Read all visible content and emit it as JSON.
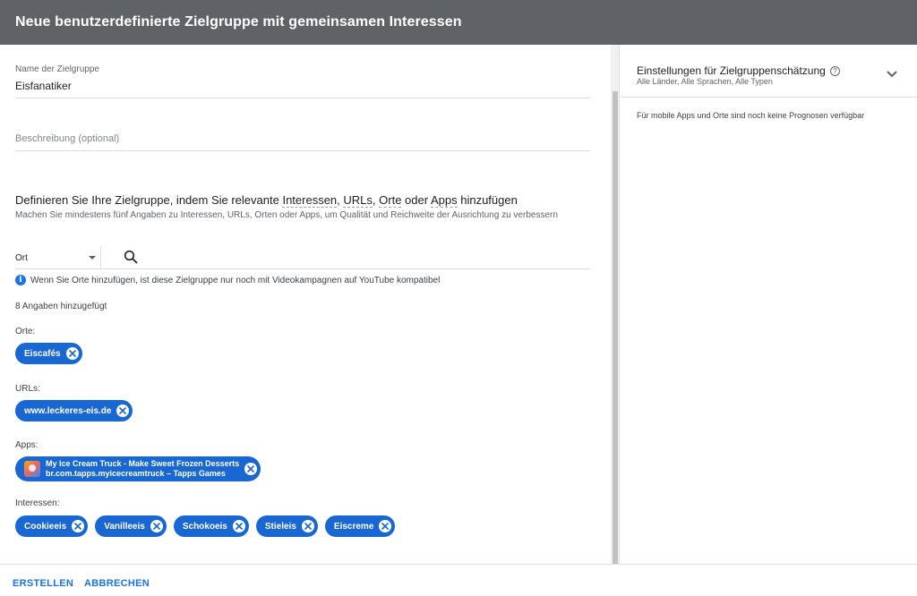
{
  "header": {
    "title": "Neue benutzerdefinierte Zielgruppe mit gemeinsamen Interessen"
  },
  "form": {
    "name_label": "Name der Zielgruppe",
    "name_value": "Eisfanatiker",
    "description_placeholder": "Beschreibung (optional)"
  },
  "define": {
    "title_prefix": "Definieren Sie Ihre Zielgruppe, indem Sie relevante ",
    "interests": "Interessen",
    "comma1": ", ",
    "urls": "URLs",
    "comma2": ", ",
    "places": "Orte",
    "or": " oder ",
    "apps": "Apps",
    "title_suffix": " hinzufügen",
    "subtitle": "Machen Sie mindestens fünf Angaben zu Interessen, URLs, Orten oder Apps, um Qualität und Reichweite der Ausrichtung zu verbessern"
  },
  "search": {
    "type_selected": "Ort"
  },
  "info": {
    "icon": "info-icon",
    "text": "Wenn Sie Orte hinzufügen, ist diese Zielgruppe nur noch mit Videokampagnen auf YouTube kompatibel"
  },
  "count_text": "8 Angaben hinzugefügt",
  "groups": {
    "places": {
      "label": "Orte:",
      "chips": [
        "Eiscafés"
      ]
    },
    "urls": {
      "label": "URLs:",
      "chips": [
        "www.leckeres-eis.de"
      ]
    },
    "apps": {
      "label": "Apps:",
      "app": {
        "name": "My Ice Cream Truck - Make Sweet Frozen Desserts",
        "id": "br.com.tapps.myicecreamtruck – Tapps Games"
      }
    },
    "interests": {
      "label": "Interessen:",
      "chips": [
        "Cookieeis",
        "Vanilleeis",
        "Schokoeis",
        "Stieleis",
        "Eiscreme"
      ]
    }
  },
  "side_panel": {
    "title": "Einstellungen für Zielgruppenschätzung",
    "subtitle": "Alle Länder, Alle Sprachen, Alle Typen",
    "note": "Für mobile Apps und Orte sind noch keine Prognosen verfügbar"
  },
  "footer": {
    "create": "ERSTELLEN",
    "cancel": "ABBRECHEN"
  },
  "colors": {
    "header": "#5f6368",
    "chip": "#1967d2",
    "accent": "#1a73e8"
  }
}
